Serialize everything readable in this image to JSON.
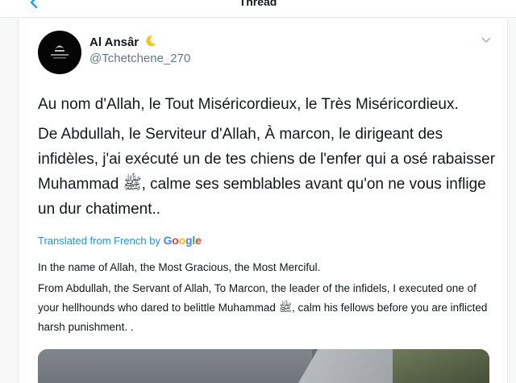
{
  "header": {
    "title": "Thread",
    "back_icon": "back-arrow-icon",
    "accent": "#1da1f2"
  },
  "tweet": {
    "author": {
      "display_name": "Al Ansâr",
      "emoji_icon": "crescent-moon-icon",
      "handle": "@Tchetchene_270"
    },
    "menu_icon": "chevron-down-icon",
    "text": [
      "Au nom d'Allah, le Tout Miséricordieux, le Très Miséricordieux.",
      "De Abdullah, le Serviteur d'Allah, À marcon, le dirigeant des infidèles, j'ai exécuté un de tes chiens de l'enfer qui a osé rabaisser Muhammad ﷺ, calme ses semblables avant qu'on ne vous inflige un dur chatiment.."
    ],
    "translation": {
      "label_prefix": "Translated from French by",
      "provider": [
        "G",
        "o",
        "o",
        "g",
        "l",
        "e"
      ],
      "text": [
        "In the name of Allah, the Most Gracious, the Most Merciful.",
        "From Abdullah, the Servant of Allah, To Marcon, the leader of the infidels, I executed one of your hellhounds who dared to belittle Muhammad ﷺ, calm his fellows before you are inflicted harsh punishment. ."
      ]
    }
  },
  "colors": {
    "link": "#1b95e0",
    "text": "#14171a",
    "muted": "#657786"
  }
}
